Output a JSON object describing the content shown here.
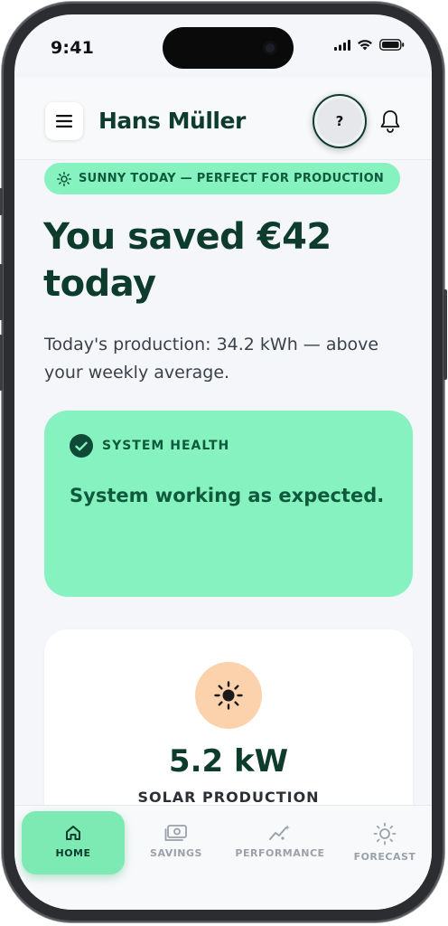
{
  "status_bar": {
    "time": "9:41"
  },
  "header": {
    "menu_icon": "hamburger-icon",
    "user_name": "Hans Müller",
    "help_label": "?",
    "notification_icon": "bell-icon"
  },
  "weather": {
    "icon": "sun-icon",
    "text": "SUNNY TODAY — PERFECT FOR PRODUCTION"
  },
  "hero": {
    "headline": "You saved €42 today",
    "subtext": "Today's production: 34.2 kWh — above your weekly average."
  },
  "health": {
    "icon": "check-circle-icon",
    "label": "SYSTEM HEALTH",
    "message": "System working as expected."
  },
  "solar": {
    "icon": "sun-icon",
    "value": "5.2 kW",
    "label": "SOLAR PRODUCTION"
  },
  "tabs": [
    {
      "label": "HOME",
      "icon": "home-icon",
      "active": true
    },
    {
      "label": "SAVINGS",
      "icon": "money-icon",
      "active": false
    },
    {
      "label": "PERFORMANCE",
      "icon": "chart-sparkle-icon",
      "active": false
    },
    {
      "label": "FORECAST",
      "icon": "sun-outline-icon",
      "active": false
    }
  ],
  "colors": {
    "accent_green": "#86f2bf",
    "dark_green": "#0d3b2c",
    "sun_orange": "#fbd2ab",
    "background": "#f4f6fa"
  }
}
